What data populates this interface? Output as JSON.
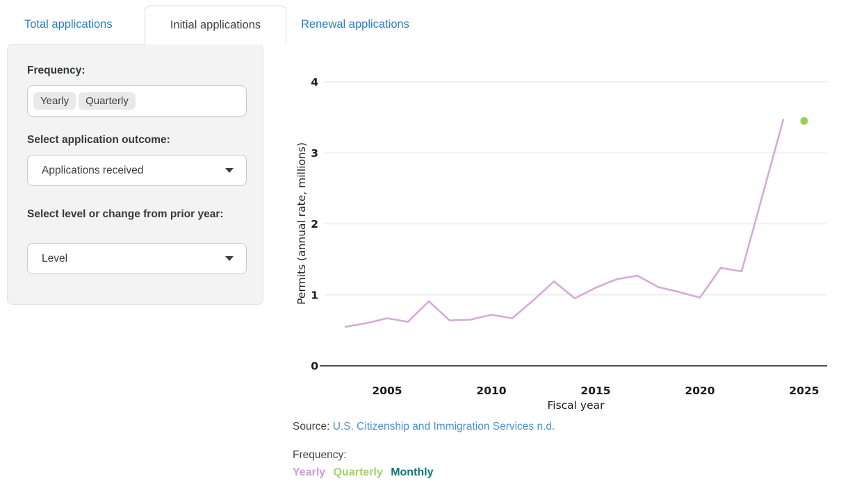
{
  "tabs": {
    "items": [
      {
        "label": "Total applications",
        "active": false
      },
      {
        "label": "Initial applications",
        "active": true
      },
      {
        "label": "Renewal applications",
        "active": false
      }
    ]
  },
  "sidebar": {
    "frequency_label": "Frequency:",
    "frequency_options": [
      {
        "label": "Yearly"
      },
      {
        "label": "Quarterly"
      }
    ],
    "outcome_label": "Select application outcome:",
    "outcome_value": "Applications received",
    "level_label": "Select level or change from prior year:",
    "level_value": "Level"
  },
  "chart_data": {
    "type": "line",
    "title": "",
    "xlabel": "Fiscal year",
    "ylabel": "Permits (annual rate, millions)",
    "xlim": [
      2002,
      2026.1
    ],
    "ylim": [
      0,
      4
    ],
    "x_ticks": [
      2005,
      2010,
      2015,
      2020,
      2025
    ],
    "y_ticks": [
      0,
      1,
      2,
      3,
      4
    ],
    "grid": true,
    "series": [
      {
        "name": "Initial applications received (yearly)",
        "color": "#d9a8db",
        "x": [
          2003,
          2004,
          2005,
          2006,
          2007,
          2008,
          2009,
          2010,
          2011,
          2012,
          2013,
          2014,
          2015,
          2016,
          2017,
          2018,
          2019,
          2020,
          2021,
          2022,
          2023,
          2024
        ],
        "values": [
          0.55,
          0.6,
          0.67,
          0.62,
          0.91,
          0.64,
          0.65,
          0.72,
          0.67,
          0.92,
          1.19,
          0.95,
          1.1,
          1.22,
          1.27,
          1.11,
          1.04,
          0.96,
          1.38,
          1.33,
          2.4,
          3.47
        ]
      }
    ],
    "latest_point": {
      "x": 2025,
      "value": 3.45,
      "color": "#95d04f"
    }
  },
  "footer": {
    "source_prefix": "Source: ",
    "source_link": "U.S. Citizenship and Immigration Services n.d.",
    "frequency_label": "Frequency:",
    "legend": [
      {
        "label": "Yearly",
        "color": "#cb9fd4"
      },
      {
        "label": "Quarterly",
        "color": "#a0d46e"
      },
      {
        "label": "Monthly",
        "color": "#0e796d"
      }
    ]
  },
  "colors": {
    "tab_link": "#2a7cc2",
    "active_tab_text": "#3f4245",
    "panel_bg": "#f3f3f3",
    "gridline": "#e8e8e8",
    "axis_line": "#141414",
    "chart_text": "#1a1a1a",
    "link_blue": "#4a90cd"
  }
}
